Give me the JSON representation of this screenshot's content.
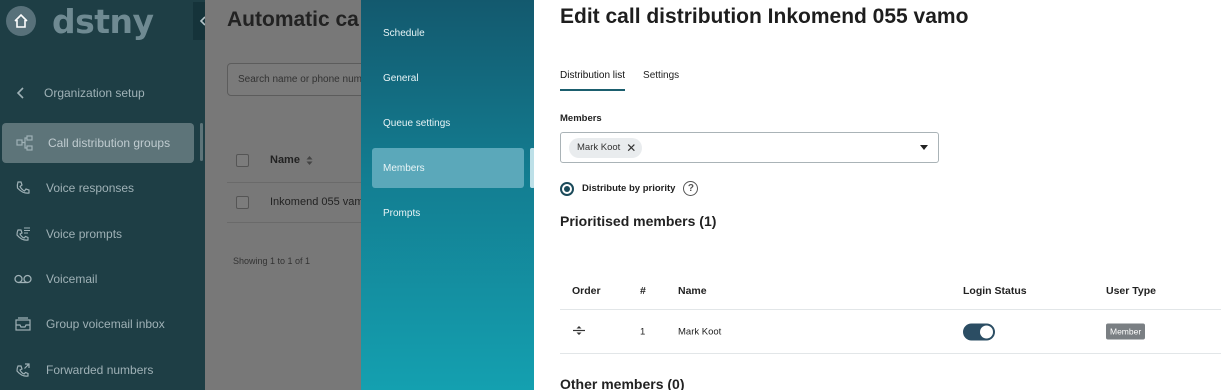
{
  "sidebar": {
    "logo": "dstny",
    "back_label": "Organization setup",
    "items": [
      {
        "label": "Call distribution groups",
        "icon": "hierarchy-icon"
      },
      {
        "label": "Voice responses",
        "icon": "phone-icon"
      },
      {
        "label": "Voice prompts",
        "icon": "phone-voice-icon"
      },
      {
        "label": "Voicemail",
        "icon": "voicemail-icon"
      },
      {
        "label": "Group voicemail inbox",
        "icon": "inbox-icon"
      },
      {
        "label": "Forwarded numbers",
        "icon": "phone-forward-icon"
      }
    ]
  },
  "page": {
    "title": "Automatic ca",
    "search_placeholder": "Search name or phone numb",
    "column_name": "Name",
    "row_name": "Inkomend 055 vam",
    "showing": "Showing 1 to 1 of 1"
  },
  "panel": {
    "items": [
      "Schedule",
      "General",
      "Queue settings",
      "Members",
      "Prompts"
    ],
    "active": "Members"
  },
  "edit": {
    "title": "Edit call distribution Inkomend 055 vamo",
    "tabs": [
      "Distribution list",
      "Settings"
    ],
    "members_label": "Members",
    "selected_member": "Mark Koot",
    "distribute_label": "Distribute by priority",
    "prioritised_title": "Prioritised members (1)",
    "other_title": "Other members (0)",
    "columns": {
      "order": "Order",
      "num": "#",
      "name": "Name",
      "login": "Login Status",
      "type": "User Type"
    },
    "rows": [
      {
        "num": "1",
        "name": "Mark Koot",
        "login_on": true,
        "type": "Member"
      }
    ]
  }
}
